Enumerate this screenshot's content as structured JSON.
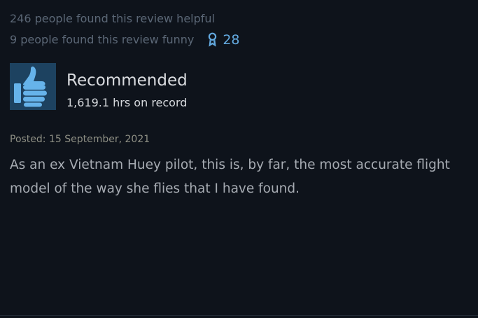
{
  "review": {
    "helpful_text": "246 people found this review helpful",
    "funny_text": "9 people found this review funny",
    "award": {
      "icon": "award-ribbon-icon",
      "count": "28",
      "color": "#63a9df"
    },
    "verdict": {
      "icon": "thumbs-up-icon",
      "label": "Recommended",
      "hours": "1,619.1 hrs on record"
    },
    "posted": "Posted: 15 September, 2021",
    "body": "As an ex Vietnam Huey pilot, this is, by far, the most accurate flight model of the way she flies that I have found."
  },
  "colors": {
    "background": "#0e131b",
    "muted_text": "#5b6776",
    "posted_text": "#8e8f84",
    "body_text": "#a6abb2",
    "thumb_box": "#1d4260",
    "thumb_icon": "#66b3ea"
  }
}
